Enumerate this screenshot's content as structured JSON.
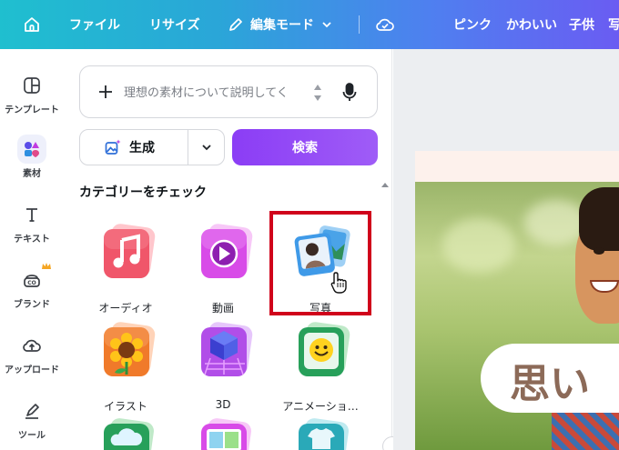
{
  "topbar": {
    "file": "ファイル",
    "resize": "リサイズ",
    "edit_mode": "編集モード",
    "tags": [
      "ピンク",
      "かわいい",
      "子供",
      "写"
    ]
  },
  "rail": {
    "items": [
      {
        "label": "テンプレート",
        "icon": "template-icon"
      },
      {
        "label": "素材",
        "icon": "elements-icon"
      },
      {
        "label": "テキスト",
        "icon": "text-icon"
      },
      {
        "label": "ブランド",
        "icon": "brand-icon"
      },
      {
        "label": "アップロード",
        "icon": "upload-icon"
      },
      {
        "label": "ツール",
        "icon": "tools-icon"
      }
    ]
  },
  "search": {
    "placeholder": "理想の素材について説明してく"
  },
  "buttons": {
    "generate": "生成",
    "search": "検索"
  },
  "categories": {
    "title": "カテゴリーをチェック",
    "items": [
      {
        "label": "オーディオ",
        "icon": "music-note-icon",
        "color": "#f0566a"
      },
      {
        "label": "動画",
        "icon": "play-icon",
        "color": "#d84be8"
      },
      {
        "label": "写真",
        "icon": "photo-icon",
        "color": "#3f9ae8"
      },
      {
        "label": "イラスト",
        "icon": "sunflower-icon",
        "color": "#f07a2a"
      },
      {
        "label": "3D",
        "icon": "cube-icon",
        "color": "#b14ee8"
      },
      {
        "label": "アニメーショ…",
        "icon": "smiley-icon",
        "color": "#27a05a"
      }
    ]
  },
  "canvas": {
    "bubble_text": "思い"
  },
  "colors": {
    "accent": "#8b3df5",
    "highlight": "#d0021b"
  }
}
